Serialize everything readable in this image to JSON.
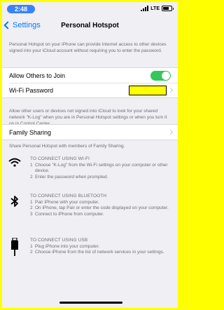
{
  "status_bar": {
    "time": "2:48",
    "carrier": "LTE"
  },
  "nav": {
    "back_label": "Settings",
    "title": "Personal Hotspot"
  },
  "intro_text": "Personal Hotspot on your iPhone can provide Internet access to other devices signed into your iCloud account without requiring you to enter the password.",
  "settings": {
    "allow_others": {
      "label": "Allow Others to Join",
      "on": true
    },
    "wifi_password": {
      "label": "Wi-Fi Password",
      "value": ""
    }
  },
  "middle_text": "Allow other users or devices not signed into iCloud to look for your shared network \"K-Log\" when you are in Personal Hotspot settings or when you turn it on in Control Center.",
  "family_sharing": {
    "label": "Family Sharing"
  },
  "family_text": "Share Personal Hotspot with members of Family Sharing.",
  "connect": {
    "wifi": {
      "heading": "TO CONNECT USING WI-FI",
      "steps": [
        {
          "num": "1",
          "text": "Choose \"K-Log\" from the Wi-Fi settings on your computer or other device."
        },
        {
          "num": "2",
          "text": "Enter the password when prompted."
        }
      ]
    },
    "bluetooth": {
      "heading": "TO CONNECT USING BLUETOOTH",
      "steps": [
        {
          "num": "1",
          "text": "Pair iPhone with your computer."
        },
        {
          "num": "2",
          "text": "On iPhone, tap Pair or enter the code displayed on your computer."
        },
        {
          "num": "3",
          "text": "Connect to iPhone from computer."
        }
      ]
    },
    "usb": {
      "heading": "TO CONNECT USING USB",
      "steps": [
        {
          "num": "1",
          "text": "Plug iPhone into your computer."
        },
        {
          "num": "2",
          "text": "Choose iPhone from the list of network services in your settings."
        }
      ]
    }
  },
  "colors": {
    "accent": "#007aff",
    "toggle_on": "#34c759",
    "highlight": "#ffff00",
    "time_pill": "#3b82f6"
  }
}
